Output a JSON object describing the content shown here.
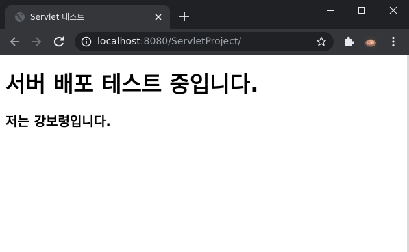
{
  "browser": {
    "tab": {
      "title": "Servlet 테스트"
    },
    "address_bar": {
      "host": "localhost",
      "rest": ":8080/ServletProject/"
    }
  },
  "page": {
    "heading": "서버 배포 테스트 중입니다.",
    "subheading": "저는 강보령입니다."
  },
  "colors": {
    "titlebar": "#202124",
    "toolbar": "#35363a",
    "omnibox": "#202124",
    "text_light": "#e8eaed",
    "text_muted": "#9aa0a6"
  }
}
